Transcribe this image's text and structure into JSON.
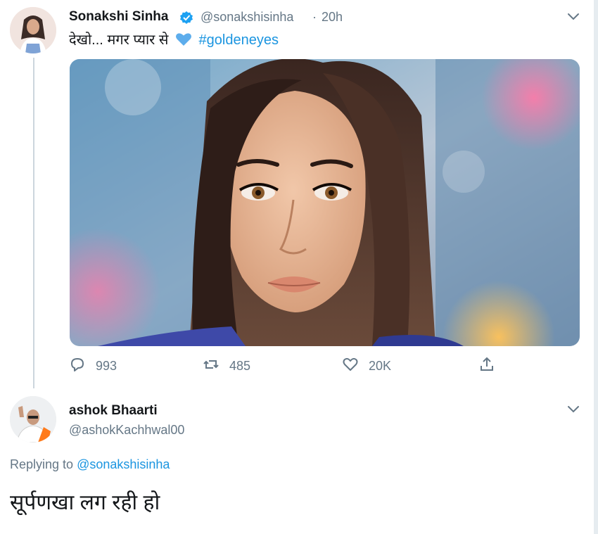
{
  "tweet": {
    "author_name": "Sonakshi Sinha",
    "handle": "@sonakshisinha",
    "separator": "·",
    "time": "20h",
    "text_prefix": "देखो... मगर प्यार से",
    "heart_emoji": "💙",
    "hashtag": "#goldeneyes",
    "media_icon": "portrait-photo",
    "verified_icon": "verified-badge-icon",
    "actions": {
      "replies": "993",
      "retweets": "485",
      "likes": "20K"
    }
  },
  "reply": {
    "author_name": "ashok Bhaarti",
    "handle": "@ashokKachhwal00",
    "replying_label": "Replying to",
    "replying_handle": "@sonakshisinha",
    "text": "सूर्पणखा लग रही हो"
  },
  "colors": {
    "accent": "#1b95e0",
    "muted": "#657786",
    "text": "#14171a",
    "thread_line": "#ccd6dd"
  }
}
